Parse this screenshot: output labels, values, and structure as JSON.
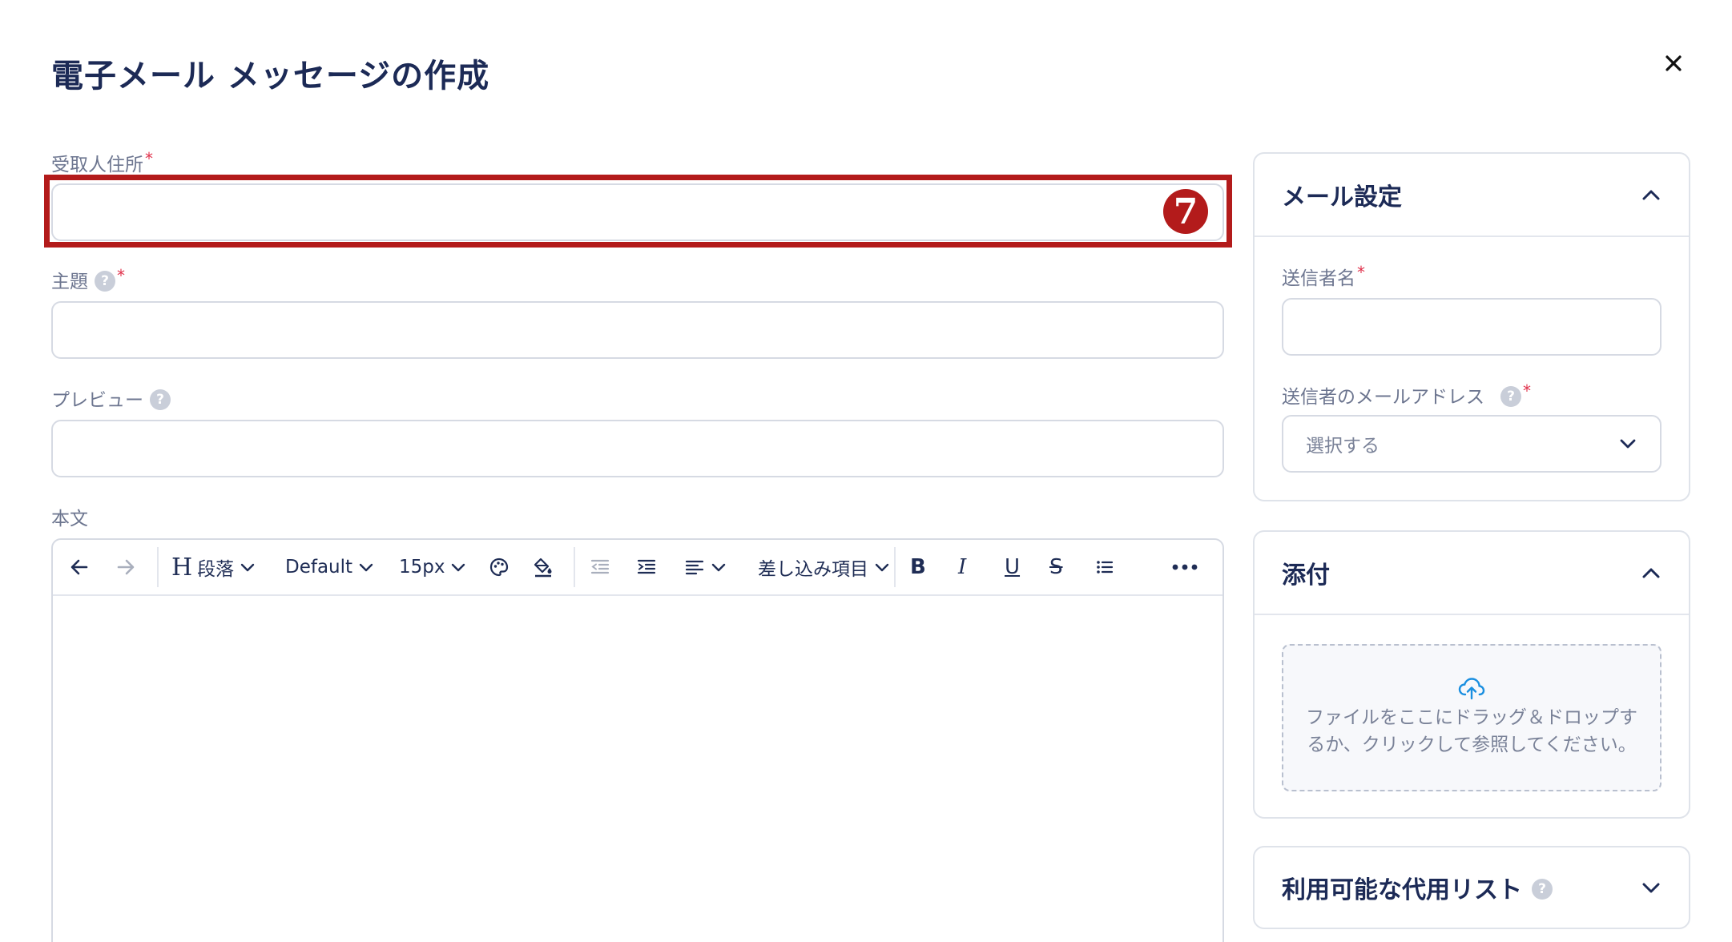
{
  "dialog": {
    "title": "電子メール メッセージの作成",
    "close_label": "×"
  },
  "fields": {
    "recipient": {
      "label": "受取人住所",
      "required": "*",
      "value": ""
    },
    "subject": {
      "label": "主題",
      "required": "*",
      "value": ""
    },
    "preview": {
      "label": "プレビュー",
      "value": ""
    },
    "body": {
      "label": "本文"
    }
  },
  "annotation": {
    "badge": "7",
    "color": "#b31b1b"
  },
  "toolbar": {
    "heading_glyph": "H",
    "paragraph": "段落",
    "font": "Default",
    "size": "15px",
    "merge_fields": "差し込み項目",
    "bold": "B",
    "italic": "I",
    "underline": "U",
    "strike": "S"
  },
  "mail_settings": {
    "title": "メール設定",
    "sender_name": {
      "label": "送信者名",
      "required": "*",
      "value": ""
    },
    "sender_email": {
      "label": "送信者のメールアドレス",
      "required": "*",
      "selected": "選択する"
    }
  },
  "attachments": {
    "title": "添付",
    "dropzone_text": "ファイルをここにドラッグ＆ドロップするか、クリックして参照してください。"
  },
  "lists": {
    "title": "利用可能な代用リスト"
  },
  "help_glyph": "?",
  "colors": {
    "accent": "#1c2a56",
    "required": "#e0314b",
    "upload": "#1a8fe0"
  }
}
